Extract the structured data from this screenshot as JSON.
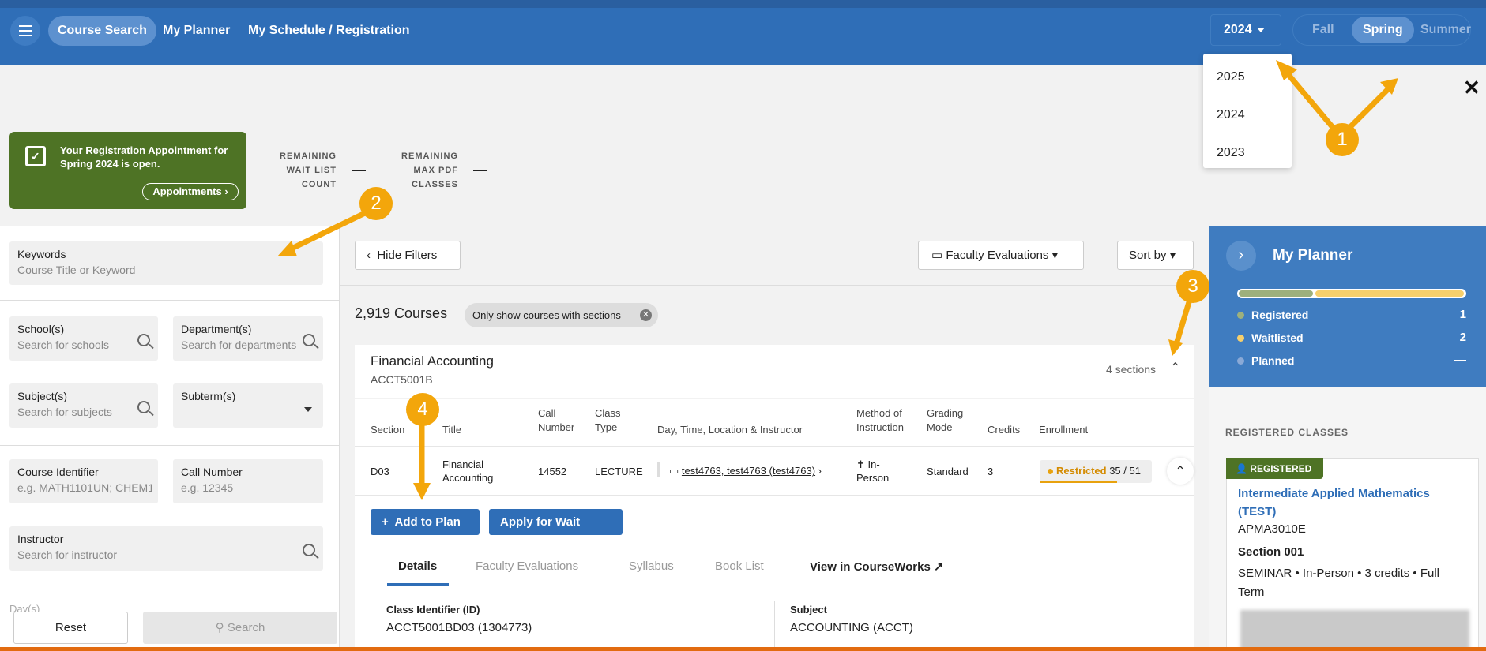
{
  "nav": {
    "links": [
      "Course Search",
      "My Planner",
      "My Schedule / Registration"
    ],
    "year": "2024",
    "terms": [
      "Fall",
      "Spring",
      "Summer"
    ],
    "active_term": "Spring",
    "year_options": [
      "2025",
      "2024",
      "2023"
    ]
  },
  "banner": {
    "message": "Your Registration Appointment for Spring 2024 is open.",
    "appointments_label": "Appointments",
    "stats": [
      {
        "label_lines": [
          "REMAINING",
          "WAIT LIST",
          "COUNT"
        ],
        "value": "—"
      },
      {
        "label_lines": [
          "REMAINING",
          "MAX PDF",
          "CLASSES"
        ],
        "value": "—"
      }
    ]
  },
  "filters": {
    "keywords": {
      "label": "Keywords",
      "placeholder": "Course Title or Keyword"
    },
    "schools": {
      "label": "School(s)",
      "placeholder": "Search for schools"
    },
    "departments": {
      "label": "Department(s)",
      "placeholder": "Search for departments"
    },
    "subjects": {
      "label": "Subject(s)",
      "placeholder": "Search for subjects"
    },
    "subterm": {
      "label": "Subterm(s)"
    },
    "course_identifier": {
      "label": "Course Identifier",
      "placeholder": "e.g. MATH1101UN; CHEM1:"
    },
    "call_number": {
      "label": "Call Number",
      "placeholder": "e.g. 12345"
    },
    "instructor": {
      "label": "Instructor",
      "placeholder": "Search for instructor"
    },
    "days_label": "Day(s)",
    "reset_label": "Reset",
    "search_label": "Search"
  },
  "toolbar": {
    "hide_filters": "Hide Filters",
    "faculty_evaluations": "Faculty Evaluations",
    "sort_by": "Sort by"
  },
  "results": {
    "count": "2,919 Courses",
    "chip": "Only show courses with sections"
  },
  "course": {
    "title": "Financial Accounting",
    "code": "ACCT5001B",
    "sections_count": "4 sections",
    "headers": [
      "Section",
      "Title",
      "Call Number",
      "Class Type",
      "Day, Time, Location & Instructor",
      "Method of Instruction",
      "Grading Mode",
      "Credits",
      "Enrollment"
    ],
    "row": {
      "section": "D03",
      "title": "Financial Accounting",
      "call_number": "14552",
      "class_type": "LECTURE",
      "instructor": "test4763, test4763 (test4763)",
      "method": "In-Person",
      "grading": "Standard",
      "credits": "3",
      "enrollment_status": "Restricted",
      "enrollment_count": "35 / 51",
      "enrollment_fill": 0.69
    },
    "add_to_plan": "Add to Plan",
    "wait_list": "Apply for Wait List...",
    "tabs": [
      "Details",
      "Faculty Evaluations",
      "Syllabus",
      "Book List",
      "View in CourseWorks"
    ],
    "details": [
      {
        "label": "Class Identifier (ID)",
        "value": "ACCT5001BD03 (1304773)"
      },
      {
        "label": "Subject",
        "value": "ACCOUNTING (ACCT)"
      }
    ]
  },
  "planner": {
    "title": "My Planner",
    "legend": [
      {
        "label": "Registered",
        "value": "1",
        "color": "#9db07c"
      },
      {
        "label": "Waitlisted",
        "value": "2",
        "color": "#f6cf6c"
      },
      {
        "label": "Planned",
        "value": "—",
        "color": "#8aa9d6"
      }
    ],
    "registered_heading": "REGISTERED CLASSES",
    "class": {
      "badge": "REGISTERED",
      "title": "Intermediate Applied Mathematics (TEST)",
      "code": "APMA3010E",
      "section": "Section 001",
      "meta": "SEMINAR • In-Person • 3 credits • Full Term"
    }
  },
  "annotations": [
    "1",
    "2",
    "3",
    "4"
  ],
  "colors": {
    "brand": "#2f6eb7",
    "registered": "#4e7325",
    "annotation": "#f3a60b",
    "restricted": "#e8a20e"
  }
}
